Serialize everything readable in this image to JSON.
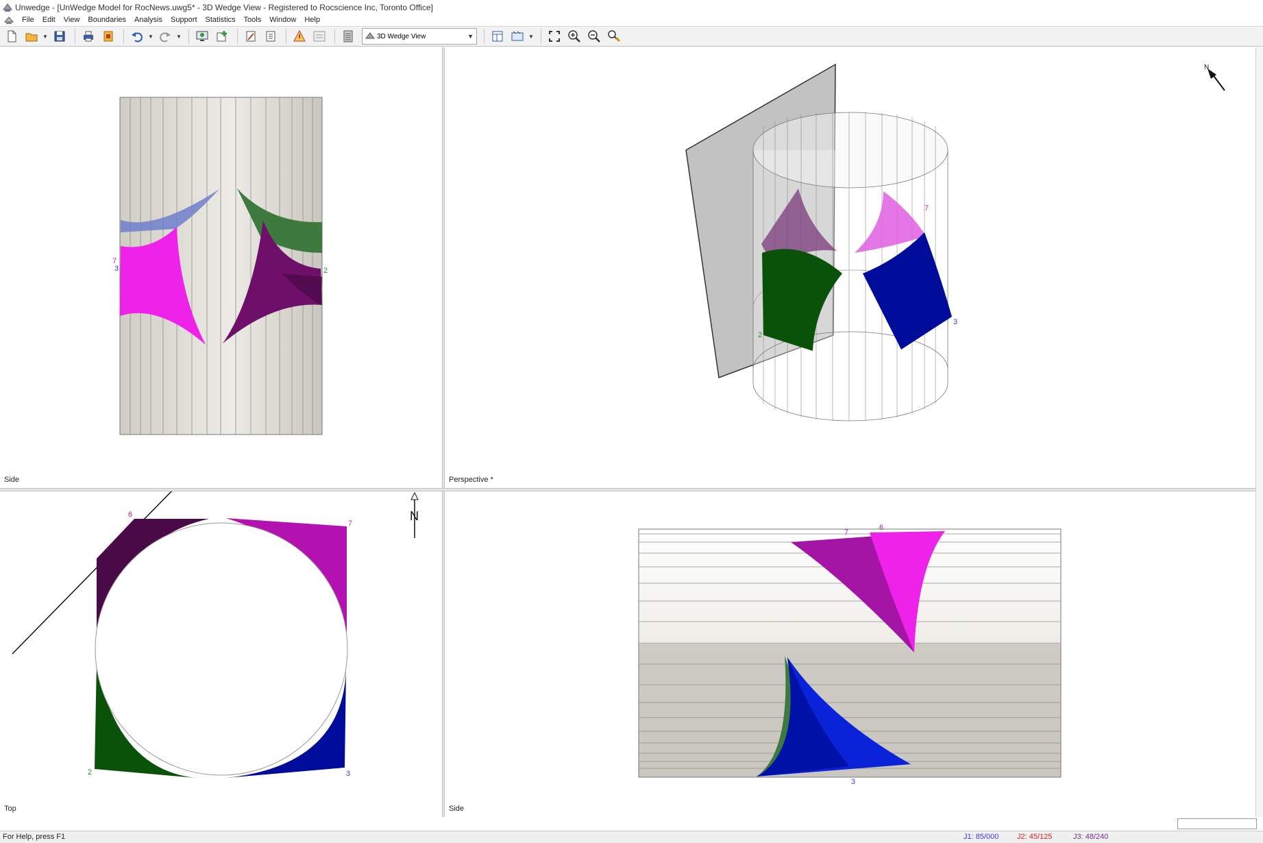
{
  "window": {
    "title": "Unwedge - [UnWedge Model for RocNews.uwg5* - 3D Wedge View - Registered to Rocscience Inc, Toronto Office]"
  },
  "menu": {
    "items": [
      "File",
      "Edit",
      "View",
      "Boundaries",
      "Analysis",
      "Support",
      "Statistics",
      "Tools",
      "Window",
      "Help"
    ]
  },
  "toolbar": {
    "view_select": "3D Wedge View",
    "icons": [
      "new-file-icon",
      "open-folder-icon",
      "save-icon",
      "print-icon",
      "export-icon",
      "undo-icon",
      "redo-icon",
      "monitor-icon",
      "add-icon",
      "edit-icon",
      "report-icon",
      "warning-icon",
      "info-icon",
      "properties-icon",
      "layout-icon",
      "display-icon",
      "zoom-extents-icon",
      "zoom-in-icon",
      "zoom-out-icon",
      "pan-icon"
    ]
  },
  "panes": {
    "top_left": {
      "label": "Side",
      "wedge_labels": {
        "w7": "7",
        "w3": "3",
        "w2": "2"
      }
    },
    "top_right": {
      "label": "Perspective *",
      "north": "N",
      "wedge_labels": {
        "w7": "7",
        "w2": "2",
        "w3": "3"
      }
    },
    "bottom_left": {
      "label": "Top",
      "north": "N",
      "wedge_labels": {
        "w6": "6",
        "w7": "7",
        "w2": "2",
        "w3": "3"
      }
    },
    "bottom_right": {
      "label": "Side",
      "wedge_labels": {
        "w7": "7",
        "w6": "6",
        "w3": "3"
      }
    }
  },
  "status": {
    "help": "For Help, press F1",
    "joints": [
      {
        "text": "J1: 85/000",
        "color": "#3b3bd6"
      },
      {
        "text": "J2: 45/125",
        "color": "#e02020"
      },
      {
        "text": "J3: 48/240",
        "color": "#7a2a8a"
      }
    ]
  }
}
